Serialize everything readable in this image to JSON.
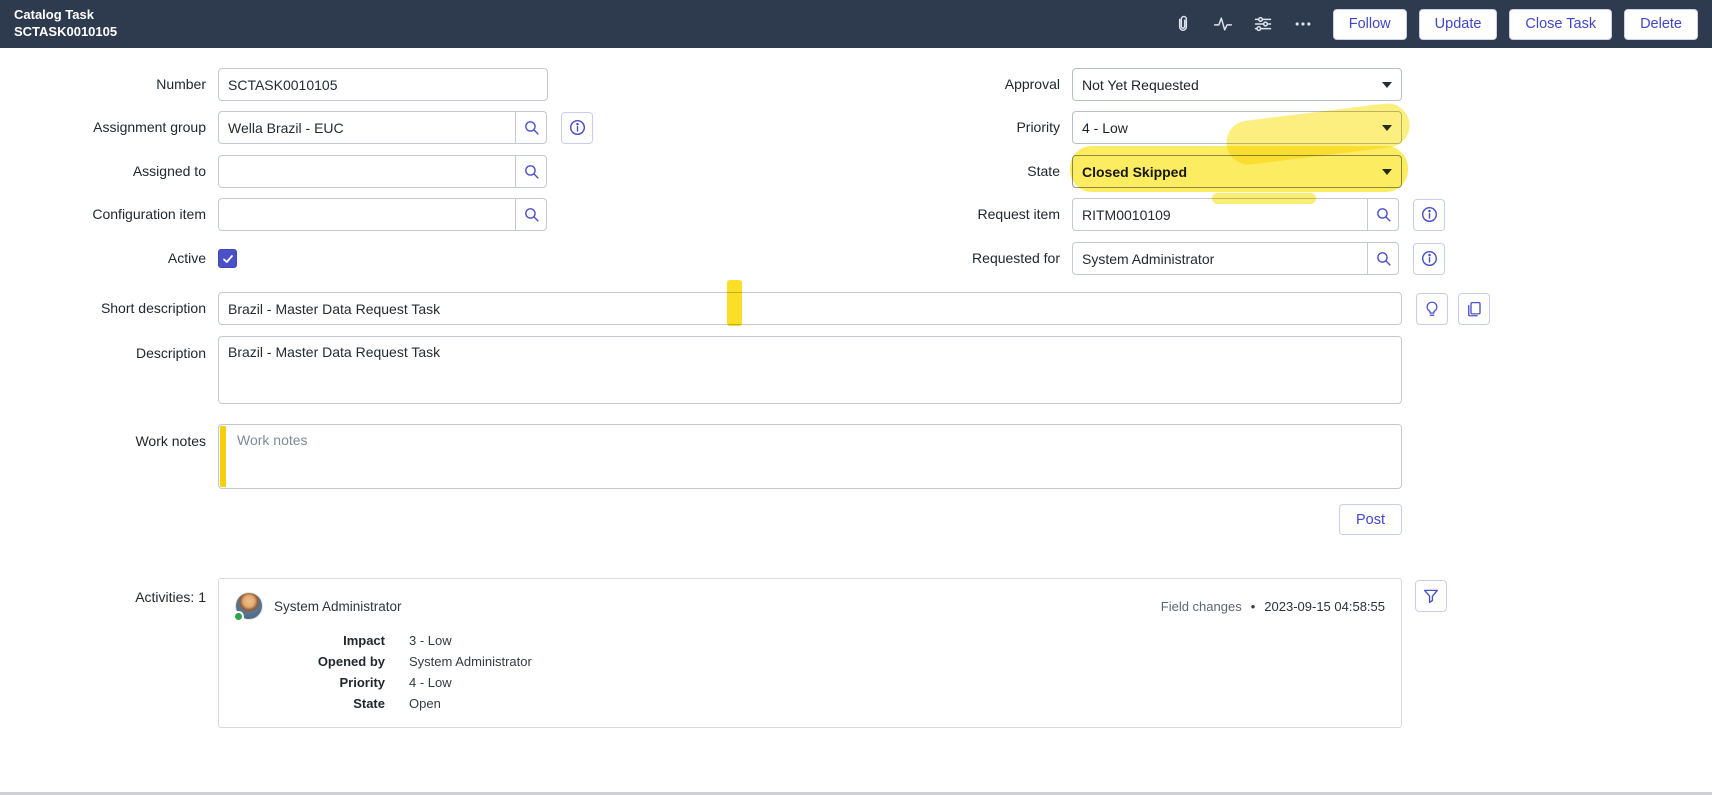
{
  "header": {
    "record_type": "Catalog Task",
    "record_number": "SCTASK0010105",
    "icons": [
      "attachment-icon",
      "activity-stream-icon",
      "personalize-form-icon",
      "more-options-icon"
    ],
    "buttons": {
      "follow": "Follow",
      "update": "Update",
      "close_task": "Close Task",
      "delete": "Delete"
    }
  },
  "fields": {
    "number": {
      "label": "Number",
      "value": "SCTASK0010105"
    },
    "assignment_group": {
      "label": "Assignment group",
      "value": "Wella Brazil - EUC"
    },
    "assigned_to": {
      "label": "Assigned to",
      "value": ""
    },
    "configuration_item": {
      "label": "Configuration item",
      "value": ""
    },
    "active": {
      "label": "Active",
      "checked": true
    },
    "short_description": {
      "label": "Short description",
      "value": "Brazil - Master Data Request Task"
    },
    "description": {
      "label": "Description",
      "value": "Brazil - Master Data Request Task"
    },
    "work_notes": {
      "label": "Work notes",
      "placeholder": "Work notes",
      "value": ""
    },
    "approval": {
      "label": "Approval",
      "value": "Not Yet Requested"
    },
    "priority": {
      "label": "Priority",
      "value": "4 - Low"
    },
    "state": {
      "label": "State",
      "value": "Closed Skipped"
    },
    "request_item": {
      "label": "Request item",
      "value": "RITM0010109"
    },
    "requested_for": {
      "label": "Requested for",
      "value": "System Administrator"
    }
  },
  "post_button_label": "Post",
  "activities": {
    "label": "Activities: 1",
    "entries": [
      {
        "author": "System Administrator",
        "type": "Field changes",
        "timestamp": "2023-09-15 04:58:55",
        "changes": [
          {
            "field": "Impact",
            "value": "3 - Low"
          },
          {
            "field": "Opened by",
            "value": "System Administrator"
          },
          {
            "field": "Priority",
            "value": "4 - Low"
          },
          {
            "field": "State",
            "value": "Open"
          }
        ]
      }
    ]
  },
  "colors": {
    "header_bg": "#2e3b4e",
    "accent_indigo": "#4147c8",
    "highlight_yellow": "#fae000",
    "worknotes_stripe": "#f7cf0b",
    "presence_green": "#2ea44f"
  }
}
